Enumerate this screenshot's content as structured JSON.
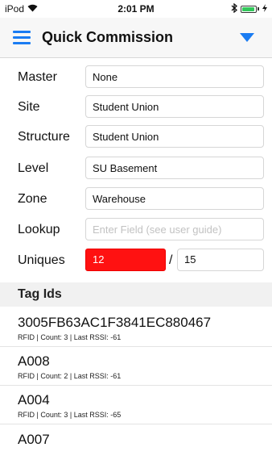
{
  "status_bar": {
    "carrier": "iPod",
    "time": "2:01 PM",
    "bluetooth": "✳"
  },
  "nav": {
    "title": "Quick Commission"
  },
  "form": {
    "master": {
      "label": "Master",
      "value": "None"
    },
    "site": {
      "label": "Site",
      "value": "Student Union"
    },
    "structure": {
      "label": "Structure",
      "value": "Student Union"
    },
    "level": {
      "label": "Level",
      "value": "SU Basement"
    },
    "zone": {
      "label": "Zone",
      "value": "Warehouse"
    },
    "lookup": {
      "label": "Lookup",
      "value": "",
      "placeholder": "Enter Field (see user guide)"
    },
    "uniques": {
      "label": "Uniques",
      "count": "12",
      "separator": "/",
      "total": "15"
    }
  },
  "tags": {
    "header": "Tag Ids",
    "items": [
      {
        "id": "3005FB63AC1F3841EC880467",
        "meta": "RFID | Count: 3 | Last RSSI: -61"
      },
      {
        "id": "A008",
        "meta": "RFID | Count: 2 | Last RSSI: -61"
      },
      {
        "id": "A004",
        "meta": "RFID | Count: 3 | Last RSSI: -65"
      },
      {
        "id": "A007",
        "meta": ""
      }
    ]
  },
  "colors": {
    "accent": "#1a7cf2",
    "alert": "#ff1111",
    "battery": "#32c85a"
  }
}
